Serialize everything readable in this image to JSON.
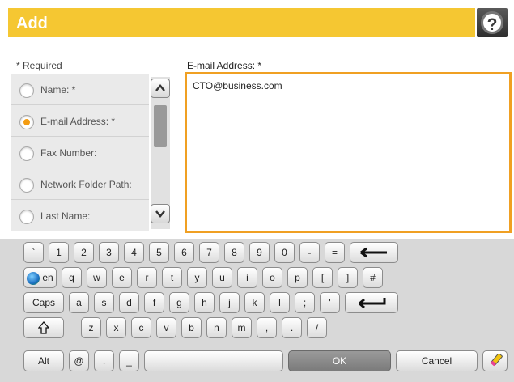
{
  "header": {
    "title": "Add",
    "help_glyph": "?"
  },
  "form": {
    "required_note": "* Required",
    "fields": [
      {
        "label": "Name: *",
        "selected": false
      },
      {
        "label": "E-mail Address: *",
        "selected": true
      },
      {
        "label": "Fax Number:",
        "selected": false
      },
      {
        "label": "Network Folder Path:",
        "selected": false
      },
      {
        "label": "Last Name:",
        "selected": false
      }
    ],
    "field_label": "E-mail Address: *",
    "field_value": "CTO@business.com"
  },
  "keyboard": {
    "row1": [
      "`",
      "1",
      "2",
      "3",
      "4",
      "5",
      "6",
      "7",
      "8",
      "9",
      "0",
      "-",
      "="
    ],
    "row2": [
      "q",
      "w",
      "e",
      "r",
      "t",
      "y",
      "u",
      "i",
      "o",
      "p",
      "[",
      "]",
      "#"
    ],
    "row3": [
      "a",
      "s",
      "d",
      "f",
      "g",
      "h",
      "j",
      "k",
      "l",
      ";",
      "'"
    ],
    "row4": [
      "z",
      "x",
      "c",
      "v",
      "b",
      "n",
      "m",
      ",",
      ".",
      "/"
    ],
    "lang_label": "en",
    "caps_label": "Caps",
    "alt_label": "Alt",
    "at_label": "@",
    "period_label": ".",
    "underscore_label": "_",
    "ok_label": "OK",
    "cancel_label": "Cancel"
  },
  "colors": {
    "accent": "#f5c732",
    "selection": "#f39c12",
    "field_border": "#f0a023"
  }
}
